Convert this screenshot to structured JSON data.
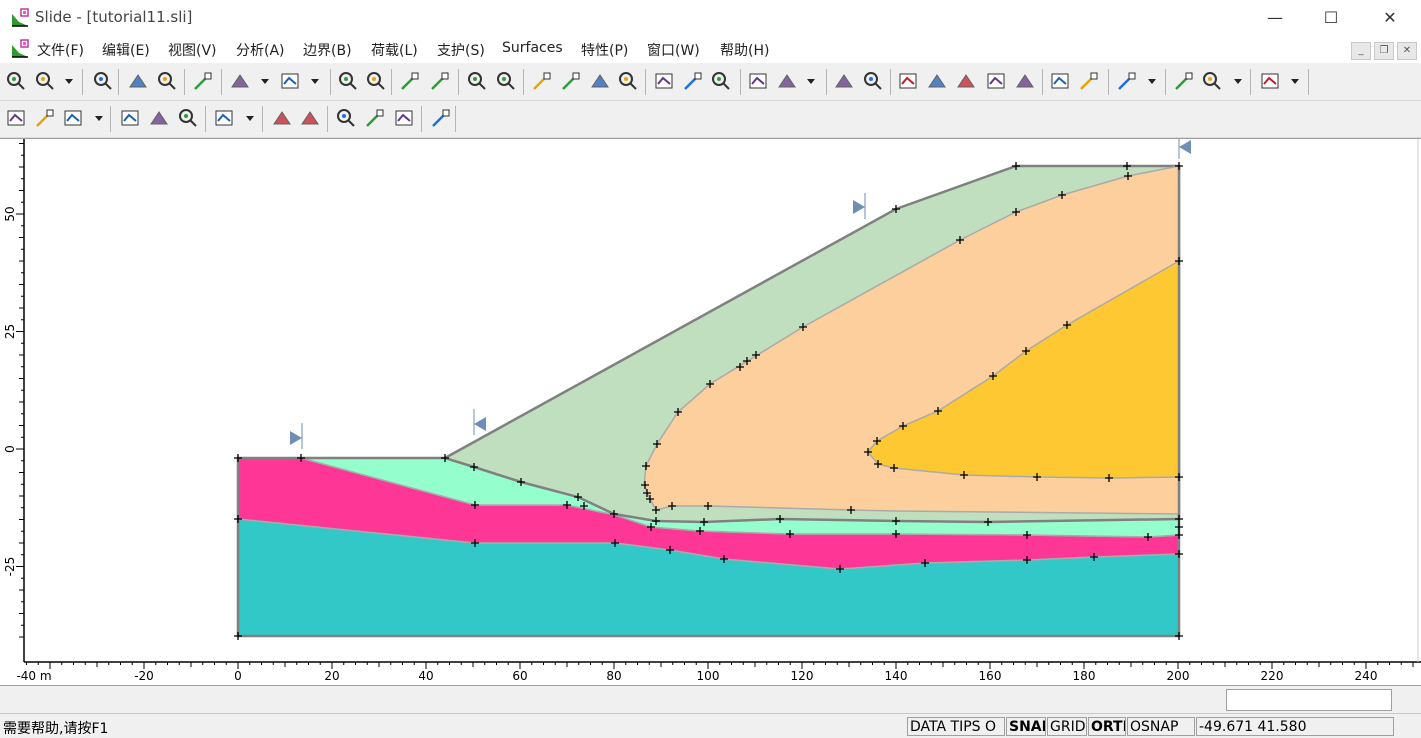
{
  "window": {
    "title": "Slide - [tutorial11.sli]",
    "minimize_glyph": "—",
    "maximize_glyph": "☐",
    "close_glyph": "✕"
  },
  "menu": [
    {
      "label": "文件(F)"
    },
    {
      "label": "编辑(E)"
    },
    {
      "label": "视图(V)"
    },
    {
      "label": "分析(A)"
    },
    {
      "label": "边界(B)"
    },
    {
      "label": "荷载(L)"
    },
    {
      "label": "支护(S)"
    },
    {
      "label": "Surfaces"
    },
    {
      "label": "特性(P)"
    },
    {
      "label": "窗口(W)"
    },
    {
      "label": "帮助(H)"
    }
  ],
  "toolbar1_icons": [
    "new-file-icon",
    "open-folder-icon",
    "save-icon",
    "print-preview-icon",
    "print-icon",
    "color-icon",
    "undo-icon",
    "redo-icon",
    "copy-icon",
    "columns-icon",
    "tools-icon",
    "compute-icon",
    "info-viewer-icon",
    "interpret-icon",
    "zoom-all-icon",
    "zoom-in-icon",
    "zoom-out-icon",
    "pan-icon",
    "zoom-window-icon",
    "zoom-extents-icon",
    "zoom-slope-icon",
    "boundary-icon",
    "material-boundary-icon",
    "water-table-icon",
    "piezo-icon",
    "delete-vertex-icon",
    "move-vertex-icon",
    "add-vertex-icon",
    "snap-icon",
    "merge-icon",
    "stage-icon",
    "rotate-icon",
    "tension-crack-icon",
    "support-icon",
    "anchor-icon",
    "grid-icon"
  ],
  "toolbar2_icons": [
    "add-slope-limits-icon",
    "edit-limits-icon",
    "add-load-icon",
    "surface-options-icon",
    "surface-yellow-icon",
    "surface-pick-icon",
    "edit-surface-icon",
    "weak-layer-icon",
    "focus-icon",
    "material-assign-icon",
    "properties-icon",
    "display-icon",
    "hand-icon"
  ],
  "plot": {
    "x_ticks": [
      "-40 m",
      "-20",
      "0",
      "20",
      "40",
      "60",
      "80",
      "100",
      "120",
      "140",
      "160",
      "180",
      "200",
      "220",
      "240"
    ],
    "y_ticks": [
      "50",
      "25",
      "0",
      "-25"
    ],
    "colors": {
      "slope_green": "#bfdfbf",
      "orange": "#fccf9c",
      "gold": "#fec832",
      "mint": "#94ffcc",
      "magenta": "#fe3796",
      "teal": "#33c8c8",
      "boundary": "#808080",
      "limit_marker": "#6e8fb4"
    }
  },
  "status": {
    "help": "需要帮助,请按F1",
    "data_tips": "DATA TIPS O",
    "snap": "SNAI",
    "grid": "GRID",
    "ortho": "ORTI",
    "osnap": "OSNAP",
    "coords": "-49.671   41.580"
  }
}
